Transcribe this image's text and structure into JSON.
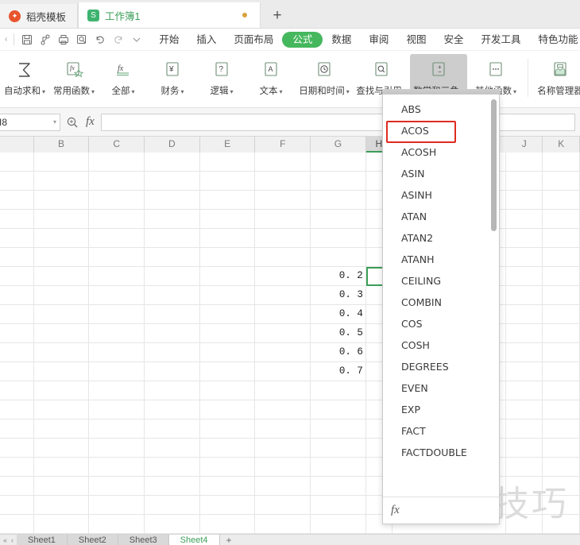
{
  "window": {
    "doc_tabs": [
      {
        "label": "稻壳模板",
        "icon": "docer-logo-icon",
        "active": false
      },
      {
        "label": "工作簿1",
        "icon": "spreadsheet-icon",
        "active": true,
        "modified": true
      }
    ],
    "new_tab_label": "+"
  },
  "quick_access": {
    "collapse_label": "‹",
    "items": [
      {
        "name": "save-icon",
        "glyph": "save"
      },
      {
        "name": "share-icon",
        "glyph": "share"
      },
      {
        "name": "print-icon",
        "glyph": "print"
      },
      {
        "name": "print-preview-icon",
        "glyph": "preview"
      },
      {
        "name": "undo-icon",
        "glyph": "undo"
      },
      {
        "name": "redo-icon",
        "glyph": "redo"
      },
      {
        "name": "customize-qat-icon",
        "glyph": "caret"
      }
    ]
  },
  "ribbon_tabs": [
    {
      "label": "开始",
      "active": false
    },
    {
      "label": "插入",
      "active": false
    },
    {
      "label": "页面布局",
      "active": false
    },
    {
      "label": "公式",
      "active": true
    },
    {
      "label": "数据",
      "active": false
    },
    {
      "label": "审阅",
      "active": false
    },
    {
      "label": "视图",
      "active": false
    },
    {
      "label": "安全",
      "active": false
    },
    {
      "label": "开发工具",
      "active": false
    },
    {
      "label": "特色功能",
      "active": false
    }
  ],
  "ribbon": {
    "buttons": [
      {
        "label": "自动求和",
        "icon": "autosum-icon",
        "dropdown": true,
        "highlighted": false
      },
      {
        "label": "常用函数",
        "icon": "common-functions-icon",
        "dropdown": true,
        "highlighted": false
      },
      {
        "label": "全部",
        "icon": "all-functions-icon",
        "dropdown": true,
        "highlighted": false
      },
      {
        "label": "财务",
        "icon": "financial-icon",
        "dropdown": true,
        "highlighted": false
      },
      {
        "label": "逻辑",
        "icon": "logical-icon",
        "dropdown": true,
        "highlighted": false
      },
      {
        "label": "文本",
        "icon": "text-icon",
        "dropdown": true,
        "highlighted": false
      },
      {
        "label": "日期和时间",
        "icon": "datetime-icon",
        "dropdown": true,
        "highlighted": false
      },
      {
        "label": "查找与引用",
        "icon": "lookup-reference-icon",
        "dropdown": true,
        "highlighted": false
      },
      {
        "label": "数学和三角",
        "icon": "math-trig-icon",
        "dropdown": true,
        "highlighted": true
      },
      {
        "label": "其他函数",
        "icon": "more-functions-icon",
        "dropdown": true,
        "highlighted": false
      },
      {
        "label": "名称管理器",
        "icon": "name-manager-icon",
        "dropdown": false,
        "highlighted": false
      }
    ]
  },
  "formula_bar": {
    "name_box_value": "I8",
    "name_box_caret": "▾",
    "zoom_icon": "search-zoom-icon",
    "fx_label": "fx",
    "input_value": "",
    "input_placeholder": ""
  },
  "grid": {
    "columns": [
      {
        "label": "",
        "width": 44,
        "selected": false
      },
      {
        "label": "B",
        "width": 72,
        "selected": false
      },
      {
        "label": "C",
        "width": 72,
        "selected": false
      },
      {
        "label": "D",
        "width": 72,
        "selected": false
      },
      {
        "label": "E",
        "width": 72,
        "selected": false
      },
      {
        "label": "F",
        "width": 72,
        "selected": false
      },
      {
        "label": "G",
        "width": 72,
        "selected": false
      },
      {
        "label": "H",
        "width": 32,
        "selected": true
      },
      {
        "label": "I",
        "width": 0,
        "selected": false
      },
      {
        "label": "J",
        "width": 48,
        "selected": false
      },
      {
        "label": "K",
        "width": 48,
        "selected": false
      }
    ],
    "selected_cell": {
      "column": "H",
      "row_index": 6
    },
    "column_g_values": [
      "0. 2",
      "0. 3",
      "0. 4",
      "0. 5",
      "0. 6",
      "0. 7"
    ],
    "data_start_row": 6,
    "total_rows": 20
  },
  "function_menu": {
    "items": [
      "ABS",
      "ACOS",
      "ACOSH",
      "ASIN",
      "ASINH",
      "ATAN",
      "ATAN2",
      "ATANH",
      "CEILING",
      "COMBIN",
      "COS",
      "COSH",
      "DEGREES",
      "EVEN",
      "EXP",
      "FACT",
      "FACTDOUBLE"
    ],
    "highlighted_item": "ACOS",
    "highlight_color": "#e02b20",
    "footer_fx": "fx",
    "scrollbar": "vertical-scrollbar"
  },
  "sheet_tabs": {
    "nav_first": "«",
    "nav_prev": "‹",
    "tabs": [
      {
        "label": "Sheet1",
        "active": false
      },
      {
        "label": "Sheet2",
        "active": false
      },
      {
        "label": "Sheet3",
        "active": false
      },
      {
        "label": "Sheet4",
        "active": true
      }
    ],
    "add_label": "+"
  },
  "watermark": {
    "text": "软件技巧"
  },
  "colors": {
    "accent_green": "#45b75d",
    "highlight_red": "#e02b20",
    "selection_green": "#3b9e58",
    "ribbon_highlight": "#cdcdcd"
  }
}
